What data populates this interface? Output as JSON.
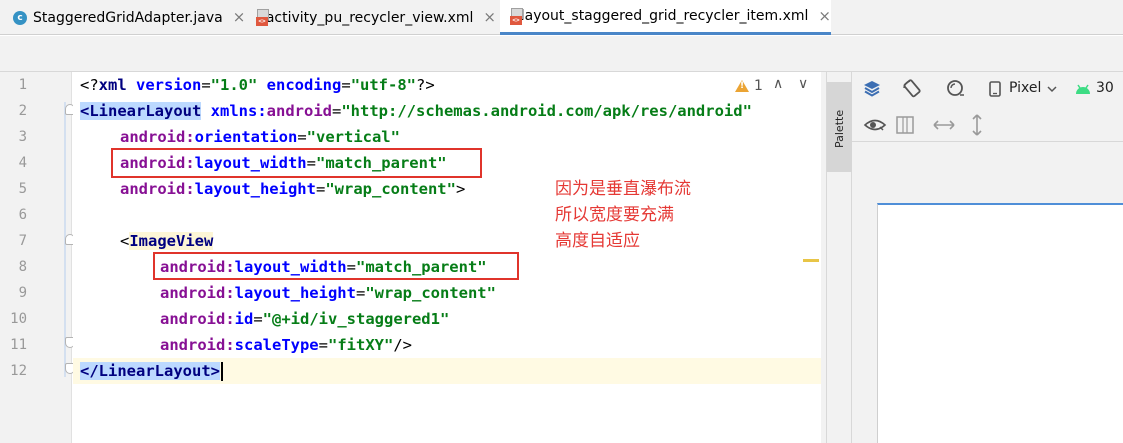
{
  "tabs": [
    {
      "label": "StaggeredGridAdapter.java",
      "icon": "java-class-icon",
      "active": false
    },
    {
      "label": "activity_pu_recycler_view.xml",
      "icon": "xml-file-icon",
      "active": false
    },
    {
      "label": "layout_staggered_grid_recycler_item.xml",
      "icon": "xml-file-icon",
      "active": true
    }
  ],
  "tab_close_glyph": "×",
  "line_numbers": [
    "1",
    "2",
    "3",
    "4",
    "5",
    "6",
    "7",
    "8",
    "9",
    "10",
    "11",
    "12"
  ],
  "code": {
    "l1": {
      "open": "<?",
      "tag": "xml ",
      "a1": "version",
      "eq1": "=",
      "v1": "\"1.0\"",
      "a2": " encoding",
      "eq2": "=",
      "v2": "\"utf-8\"",
      "close": "?>"
    },
    "l2": {
      "open": "<",
      "tag": "LinearLayout",
      "ns": " xmlns:",
      "attr": "android",
      "eq": "=",
      "val": "\"http://schemas.android.com/apk/res/android\""
    },
    "l3": {
      "ns": "android:",
      "attr": "orientation",
      "eq": "=",
      "val": "\"vertical\""
    },
    "l4": {
      "ns": "android:",
      "attr": "layout_width",
      "eq": "=",
      "val": "\"match_parent\""
    },
    "l5": {
      "ns": "android:",
      "attr": "layout_height",
      "eq": "=",
      "val": "\"wrap_content\"",
      "close": ">"
    },
    "l7": {
      "open": "<",
      "tag": "ImageView"
    },
    "l8": {
      "ns": "android:",
      "attr": "layout_width",
      "eq": "=",
      "val": "\"match_parent\""
    },
    "l9": {
      "ns": "android:",
      "attr": "layout_height",
      "eq": "=",
      "val": "\"wrap_content\""
    },
    "l10": {
      "ns": "android:",
      "attr": "id",
      "eq": "=",
      "val": "\"@+id/iv_staggered1\""
    },
    "l11": {
      "ns": "android:",
      "attr": "scaleType",
      "eq": "=",
      "val": "\"fitXY\"",
      "close": "/>"
    },
    "l12": {
      "open": "</",
      "tag": "LinearLayout",
      "close": ">"
    }
  },
  "annotation": [
    "因为是垂直瀑布流",
    "所以宽度要充满",
    "高度自适应"
  ],
  "warnings": {
    "count": "1",
    "up_arrow": "∧",
    "down_arrow": "∨"
  },
  "palette_label": "Palette",
  "device": {
    "name": "Pixel",
    "api": "30"
  },
  "colors": {
    "accent": "#4a86c8",
    "annotation_red": "#e53935",
    "tag_blue": "#000080",
    "value_green": "#067d17"
  }
}
